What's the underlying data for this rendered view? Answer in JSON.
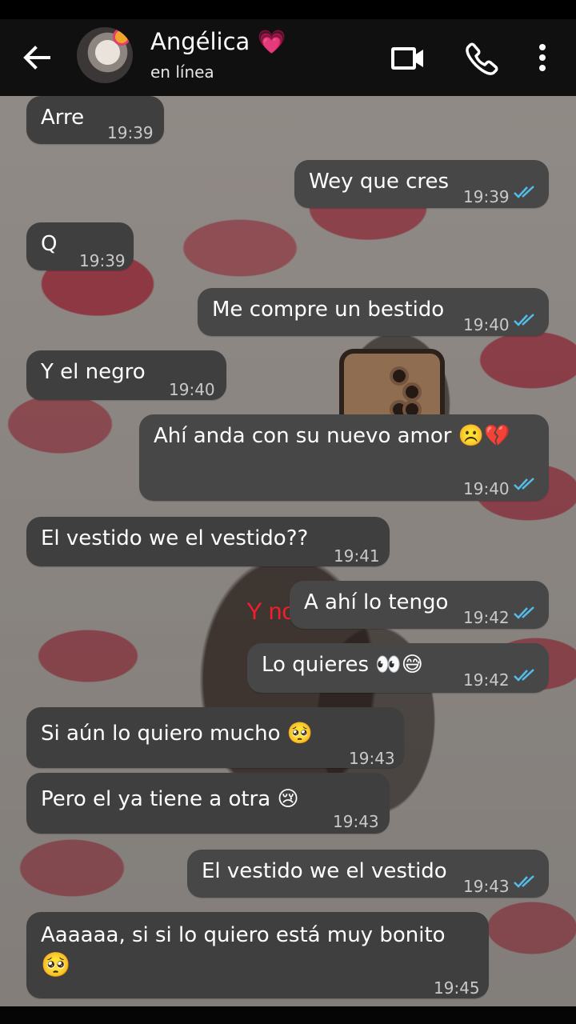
{
  "header": {
    "contact_name": "Angélica 💗",
    "status": "en línea"
  },
  "overlay_text": "Y no lo",
  "messages": [
    {
      "text": "Arre",
      "time": "19:39"
    },
    {
      "text": "Wey que cres",
      "time": "19:39"
    },
    {
      "text": "Q",
      "time": "19:39"
    },
    {
      "text": "Me compre un bestido",
      "time": "19:40"
    },
    {
      "text": "Y el negro",
      "time": "19:40"
    },
    {
      "text": "Ahí anda con su nuevo amor ☹️💔",
      "time": "19:40"
    },
    {
      "text": "El vestido we el vestido??",
      "time": "19:41"
    },
    {
      "text": "A ahí lo tengo",
      "time": "19:42"
    },
    {
      "text": "Lo quieres 👀😅",
      "time": "19:42"
    },
    {
      "text": "Si aún lo quiero mucho 🥺",
      "time": "19:43"
    },
    {
      "text": "Pero el ya tiene a otra 😢",
      "time": "19:43"
    },
    {
      "text": "El vestido we el vestido",
      "time": "19:43"
    },
    {
      "text": "Aaaaaa, si si lo quiero está muy bonito",
      "emoji": "🥺",
      "time": "19:45"
    }
  ],
  "colors": {
    "header_background": "#101010",
    "incoming_bubble": "#3f3f3f",
    "outgoing_bubble": "#474747",
    "read_ticks": "#53bdeb",
    "overlay_text": "#f21d2d"
  },
  "icons": [
    "back-arrow-icon",
    "video-call-icon",
    "voice-call-icon",
    "more-options-icon",
    "double-check-icon"
  ]
}
